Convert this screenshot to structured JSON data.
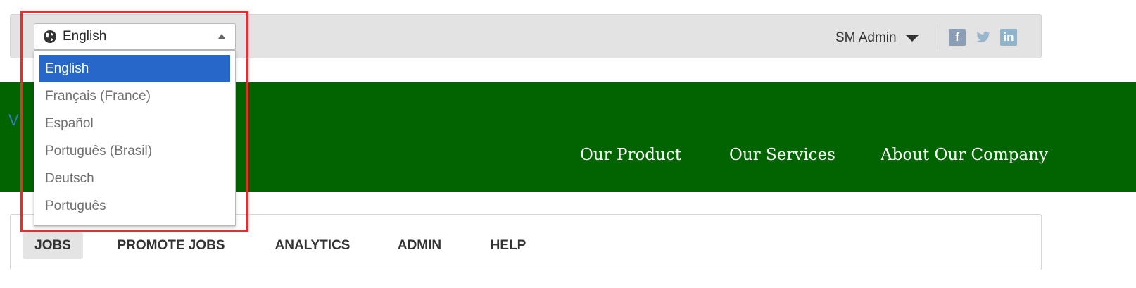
{
  "language_selector": {
    "current": "English",
    "options": [
      {
        "label": "English",
        "selected": true
      },
      {
        "label": "Français (France)",
        "selected": false
      },
      {
        "label": "Español",
        "selected": false
      },
      {
        "label": "Português (Brasil)",
        "selected": false
      },
      {
        "label": "Deutsch",
        "selected": false
      },
      {
        "label": "Português",
        "selected": false
      }
    ]
  },
  "user_menu": {
    "label": "SM Admin"
  },
  "social": [
    "facebook-icon",
    "twitter-icon",
    "linkedin-icon"
  ],
  "banner": {
    "logo_peek": "V",
    "nav": [
      "Our Product",
      "Our Services",
      "About Our Company"
    ]
  },
  "tabs": [
    {
      "label": "JOBS",
      "active": true
    },
    {
      "label": "PROMOTE JOBS",
      "active": false
    },
    {
      "label": "ANALYTICS",
      "active": false
    },
    {
      "label": "ADMIN",
      "active": false
    },
    {
      "label": "HELP",
      "active": false
    }
  ],
  "colors": {
    "banner": "#016400",
    "selected_option": "#2767c9",
    "highlight": "#ef2a2a"
  }
}
